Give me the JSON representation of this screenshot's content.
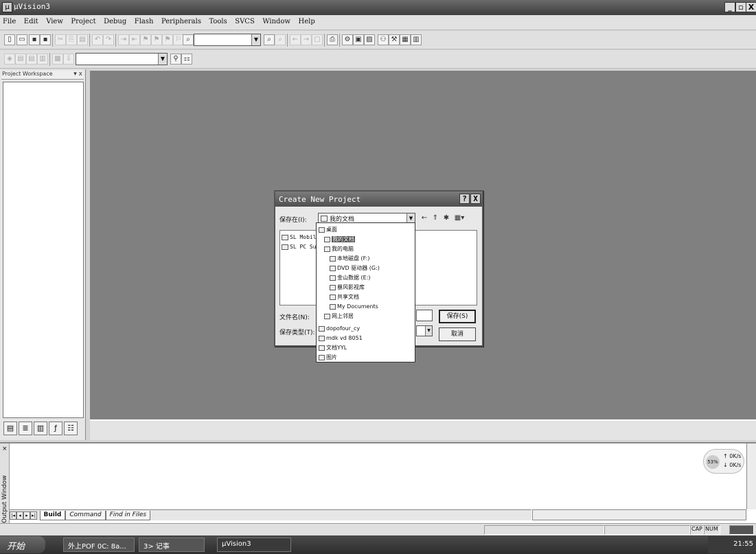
{
  "window": {
    "title": "µVision3",
    "app_icon": "µ",
    "min": "_",
    "max": "▫",
    "close": "X"
  },
  "menu": [
    "File",
    "Edit",
    "View",
    "Project",
    "Debug",
    "Flash",
    "Peripherals",
    "Tools",
    "SVCS",
    "Window",
    "Help"
  ],
  "workspace": {
    "title": "Project Workspace",
    "pin": "▾ x"
  },
  "output": {
    "label": "Output Window",
    "close": "×",
    "tabs": [
      "Build",
      "Command",
      "Find in Files"
    ],
    "net_meter": {
      "percent": "53%",
      "up": "0K/s",
      "down": "0K/s",
      "up_arrow": "↑",
      "down_arrow": "↓"
    }
  },
  "status": {
    "cap": "CAP",
    "num": "NUM"
  },
  "taskbar": {
    "start": "开始",
    "items": [
      "外上POF 0C: 8a...",
      "3> 记事",
      "µVision3"
    ],
    "clock": "21:55"
  },
  "dialog": {
    "title": "Create New Project",
    "help_btn": "?",
    "close_btn": "X",
    "save_in_label": "保存在(I):",
    "save_in_value": "我的文档",
    "file_items": [
      "SL Mobile",
      "SL PC Suit"
    ],
    "filename_label": "文件名(N):",
    "filetype_label": "保存类型(T):",
    "save_button": "保存(S)",
    "cancel_button": "取消"
  },
  "dropdown_items": [
    {
      "label": "桌面",
      "indent": 0,
      "icon": "desktop-icon"
    },
    {
      "label": "我的文档",
      "indent": 1,
      "icon": "folder-icon",
      "selected": true
    },
    {
      "label": "我的电脑",
      "indent": 1,
      "icon": "computer-icon"
    },
    {
      "label": "本地磁盘 (F:)",
      "indent": 2,
      "icon": "drive-icon"
    },
    {
      "label": "DVD 驱动器 (G:)",
      "indent": 2,
      "icon": "dvd-icon"
    },
    {
      "label": "金山数据 (E:)",
      "indent": 2,
      "icon": "drive-icon"
    },
    {
      "label": "暴风影视库",
      "indent": 2,
      "icon": "folder-icon"
    },
    {
      "label": "共享文档",
      "indent": 2,
      "icon": "folder-icon"
    },
    {
      "label": "My Documents",
      "indent": 2,
      "icon": "folder-icon"
    },
    {
      "label": "网上邻居",
      "indent": 1,
      "icon": "network-icon"
    },
    {
      "label": "dopofour_cy",
      "indent": 0,
      "icon": "folder-icon"
    },
    {
      "label": "mdk vd 8051",
      "indent": 0,
      "icon": "folder-icon"
    },
    {
      "label": "文档YYL",
      "indent": 0,
      "icon": "folder-icon"
    },
    {
      "label": "图片",
      "indent": 0,
      "icon": "folder-icon"
    }
  ]
}
